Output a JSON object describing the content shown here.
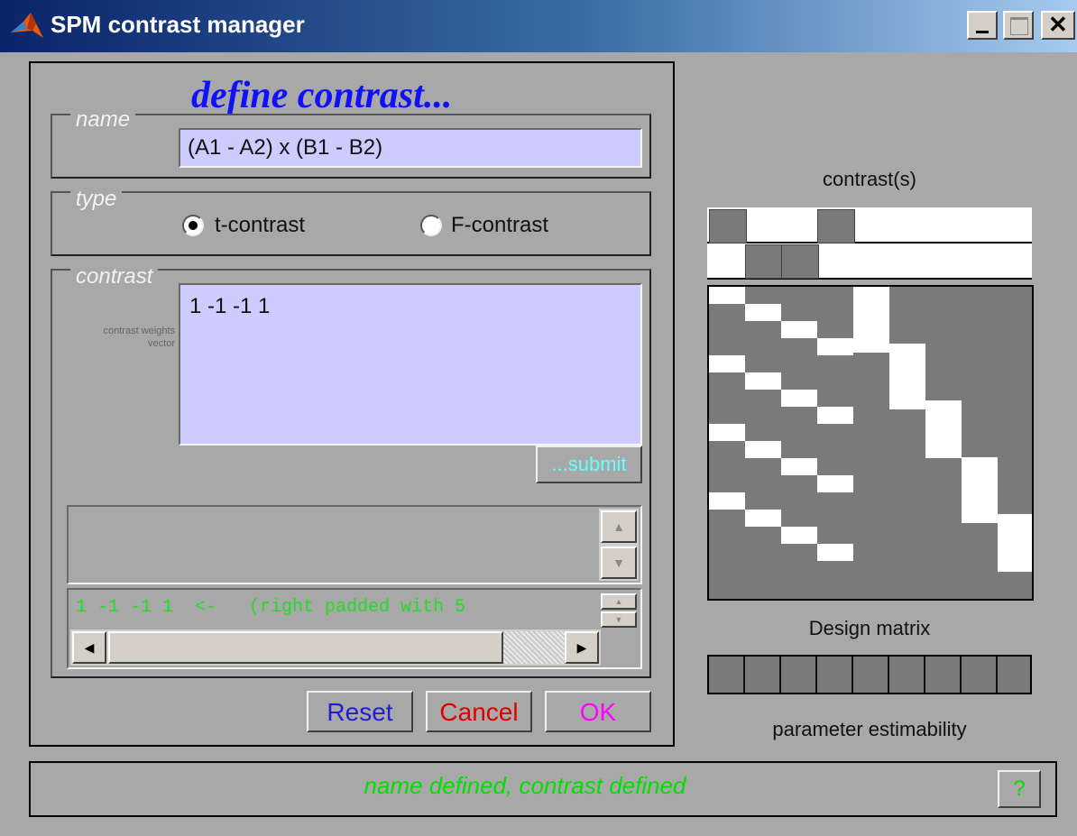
{
  "window": {
    "title": "SPM contrast manager"
  },
  "heading": "define contrast...",
  "name_group": {
    "label": "name",
    "value": "(A1 - A2) x (B1 - B2)"
  },
  "type_group": {
    "label": "type",
    "options": [
      {
        "label": "t-contrast",
        "selected": true
      },
      {
        "label": "F-contrast",
        "selected": false
      }
    ]
  },
  "contrast_group": {
    "label": "contrast",
    "side_label": "contrast weights vector",
    "value": "1 -1 -1 1",
    "submit_label": "...submit",
    "parsed_line": "1 -1 -1 1  <-   (right padded with 5"
  },
  "buttons": {
    "reset": "Reset",
    "cancel": "Cancel",
    "ok": "OK",
    "help": "?"
  },
  "status": "name defined, contrast defined",
  "right_panel": {
    "contrasts_label": "contrast(s)",
    "design_matrix_label": "Design matrix",
    "estimability_label": "parameter estimability"
  },
  "colors": {
    "heading": "#1010ff",
    "reset": "#2020d0",
    "cancel": "#e00000",
    "ok": "#ff00ff",
    "status": "#00e000",
    "submit": "#66ffff",
    "parsed": "#22dd22",
    "matrix_bg": "#7a7a7a",
    "matrix_on": "#ffffff"
  }
}
